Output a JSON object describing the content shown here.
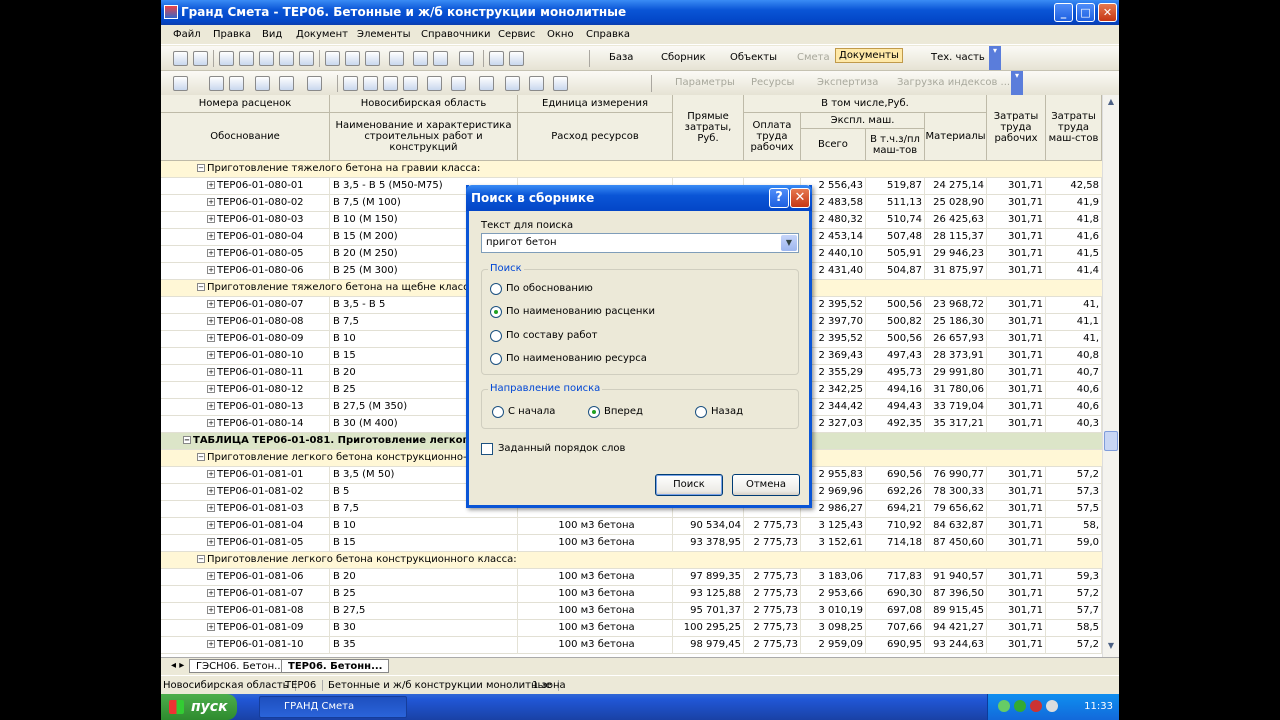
{
  "window": {
    "title": "Гранд Смета - ТЕР06. Бетонные и ж/б конструкции монолитные",
    "controls": {
      "minimize": "_",
      "restore": "□",
      "close": "✕"
    }
  },
  "menu": [
    "Файл",
    "Правка",
    "Вид",
    "Документ",
    "Элементы",
    "Справочники",
    "Сервис",
    "Окно",
    "Справка"
  ],
  "toolbar1": {
    "items": [
      {
        "label": "База",
        "icon": "database-icon",
        "disabled": false,
        "active": false
      },
      {
        "label": "Сборник",
        "icon": "collection-icon",
        "disabled": false,
        "active": false
      },
      {
        "label": "Объекты",
        "icon": "objects-icon",
        "disabled": false,
        "active": false
      },
      {
        "label": "Смета",
        "icon": "estimate-icon",
        "disabled": true,
        "active": false
      },
      {
        "label": "Документы",
        "icon": "documents-icon",
        "disabled": false,
        "active": true
      },
      {
        "label": "Тех. часть",
        "icon": "tech-part-icon",
        "disabled": false,
        "active": false
      }
    ]
  },
  "toolbar2": {
    "items": [
      {
        "label": "Параметры",
        "icon": "parameters-icon",
        "disabled": true
      },
      {
        "label": "Ресурсы",
        "icon": "resources-icon",
        "disabled": true
      },
      {
        "label": "Экспертиза",
        "icon": "expertise-icon",
        "disabled": true
      },
      {
        "label": "Загрузка индексов ...",
        "icon": "load-indexes-icon",
        "disabled": true
      }
    ]
  },
  "table": {
    "headers": {
      "col1_top": "Номера расценок",
      "col1_bottom": "Обоснование",
      "col2_top": "Новосибирская область",
      "col2_mid": "Наименование и характеристика\nстроительных работ и конструкций",
      "col3_top": "Единица измерения",
      "col3_bottom": "Расход ресурсов",
      "col4": "Прямые\nзатраты, Руб.",
      "incl": "В том числе,Руб.",
      "labor_pay": "Оплата\nтруда\nрабочих",
      "mach": "Экспл. маш.",
      "mach_total": "Всего",
      "mach_incl": "В т.ч.з/пл\nмаш-тов",
      "materials": "Материалы",
      "labor": "Затраты\nтруда\nрабочих",
      "labor_mach": "Затраты\nтруда\nмаш-стов"
    },
    "rows": [
      {
        "type": "grp",
        "text": "Приготовление тяжелого бетона на гравии класса:"
      },
      {
        "type": "item",
        "code": "ТЕР06-01-080-01",
        "name": "В 3,5 - В 5 (М50-М75)",
        "unit": "",
        "direct": "",
        "pay": "",
        "mtotal": "2 556,43",
        "mpay": "519,87",
        "mat": "24 275,14",
        "labor": "301,71",
        "lm": "42,58"
      },
      {
        "type": "item",
        "code": "ТЕР06-01-080-02",
        "name": "В 7,5 (М 100)",
        "unit": "",
        "direct": "",
        "pay": "",
        "mtotal": "2 483,58",
        "mpay": "511,13",
        "mat": "25 028,90",
        "labor": "301,71",
        "lm": "41,9"
      },
      {
        "type": "item",
        "code": "ТЕР06-01-080-03",
        "name": "В 10 (М 150)",
        "unit": "",
        "direct": "",
        "pay": "",
        "mtotal": "2 480,32",
        "mpay": "510,74",
        "mat": "26 425,63",
        "labor": "301,71",
        "lm": "41,8"
      },
      {
        "type": "item",
        "code": "ТЕР06-01-080-04",
        "name": "В 15 (М 200)",
        "unit": "",
        "direct": "",
        "pay": "",
        "mtotal": "2 453,14",
        "mpay": "507,48",
        "mat": "28 115,37",
        "labor": "301,71",
        "lm": "41,6"
      },
      {
        "type": "item",
        "code": "ТЕР06-01-080-05",
        "name": "В 20 (М 250)",
        "unit": "",
        "direct": "",
        "pay": "",
        "mtotal": "2 440,10",
        "mpay": "505,91",
        "mat": "29 946,23",
        "labor": "301,71",
        "lm": "41,5"
      },
      {
        "type": "item",
        "code": "ТЕР06-01-080-06",
        "name": "В 25 (М 300)",
        "unit": "",
        "direct": "",
        "pay": "",
        "mtotal": "2 431,40",
        "mpay": "504,87",
        "mat": "31 875,97",
        "labor": "301,71",
        "lm": "41,4"
      },
      {
        "type": "grp",
        "text": "Приготовление тяжелого бетона на щебне класса:"
      },
      {
        "type": "item",
        "code": "ТЕР06-01-080-07",
        "name": "В 3,5 - В 5",
        "unit": "",
        "direct": "",
        "pay": "",
        "mtotal": "2 395,52",
        "mpay": "500,56",
        "mat": "23 968,72",
        "labor": "301,71",
        "lm": "41,"
      },
      {
        "type": "item",
        "code": "ТЕР06-01-080-08",
        "name": "В 7,5",
        "unit": "",
        "direct": "",
        "pay": "",
        "mtotal": "2 397,70",
        "mpay": "500,82",
        "mat": "25 186,30",
        "labor": "301,71",
        "lm": "41,1"
      },
      {
        "type": "item",
        "code": "ТЕР06-01-080-09",
        "name": "В 10",
        "unit": "",
        "direct": "",
        "pay": "",
        "mtotal": "2 395,52",
        "mpay": "500,56",
        "mat": "26 657,93",
        "labor": "301,71",
        "lm": "41,"
      },
      {
        "type": "item",
        "code": "ТЕР06-01-080-10",
        "name": "В 15",
        "unit": "",
        "direct": "",
        "pay": "",
        "mtotal": "2 369,43",
        "mpay": "497,43",
        "mat": "28 373,91",
        "labor": "301,71",
        "lm": "40,8"
      },
      {
        "type": "item",
        "code": "ТЕР06-01-080-11",
        "name": "В 20",
        "unit": "",
        "direct": "",
        "pay": "",
        "mtotal": "2 355,29",
        "mpay": "495,73",
        "mat": "29 991,80",
        "labor": "301,71",
        "lm": "40,7"
      },
      {
        "type": "item",
        "code": "ТЕР06-01-080-12",
        "name": "В 25",
        "unit": "",
        "direct": "",
        "pay": "",
        "mtotal": "2 342,25",
        "mpay": "494,16",
        "mat": "31 780,06",
        "labor": "301,71",
        "lm": "40,6"
      },
      {
        "type": "item",
        "code": "ТЕР06-01-080-13",
        "name": "В 27,5 (М 350)",
        "unit": "",
        "direct": "",
        "pay": "",
        "mtotal": "2 344,42",
        "mpay": "494,43",
        "mat": "33 719,04",
        "labor": "301,71",
        "lm": "40,6"
      },
      {
        "type": "item",
        "code": "ТЕР06-01-080-14",
        "name": "В 30 (М 400)",
        "unit": "",
        "direct": "",
        "pay": "",
        "mtotal": "2 327,03",
        "mpay": "492,35",
        "mat": "35 317,21",
        "labor": "301,71",
        "lm": "40,3"
      },
      {
        "type": "tbl",
        "text": "ТАБЛИЦА ТЕР06-01-081. Приготовление легкого б"
      },
      {
        "type": "grp",
        "text": "Приготовление легкого бетона конструкционно-тепл"
      },
      {
        "type": "item",
        "code": "ТЕР06-01-081-01",
        "name": "В 3,5 (М 50)",
        "unit": "",
        "direct": "",
        "pay": "",
        "mtotal": "2 955,83",
        "mpay": "690,56",
        "mat": "76 990,77",
        "labor": "301,71",
        "lm": "57,2"
      },
      {
        "type": "item",
        "code": "ТЕР06-01-081-02",
        "name": "В 5",
        "unit": "",
        "direct": "",
        "pay": "",
        "mtotal": "2 969,96",
        "mpay": "692,26",
        "mat": "78 300,33",
        "labor": "301,71",
        "lm": "57,3"
      },
      {
        "type": "item",
        "code": "ТЕР06-01-081-03",
        "name": "В 7,5",
        "unit": "",
        "direct": "",
        "pay": "",
        "mtotal": "2 986,27",
        "mpay": "694,21",
        "mat": "79 656,62",
        "labor": "301,71",
        "lm": "57,5"
      },
      {
        "type": "item",
        "code": "ТЕР06-01-081-04",
        "name": "В 10",
        "unit": "100 м3 бетона",
        "direct": "90 534,04",
        "pay": "2 775,73",
        "mtotal": "3 125,43",
        "mpay": "710,92",
        "mat": "84 632,87",
        "labor": "301,71",
        "lm": "58,"
      },
      {
        "type": "item",
        "code": "ТЕР06-01-081-05",
        "name": "В 15",
        "unit": "100 м3 бетона",
        "direct": "93 378,95",
        "pay": "2 775,73",
        "mtotal": "3 152,61",
        "mpay": "714,18",
        "mat": "87 450,60",
        "labor": "301,71",
        "lm": "59,0"
      },
      {
        "type": "grp",
        "text": "Приготовление легкого бетона конструкционного класса:"
      },
      {
        "type": "item",
        "code": "ТЕР06-01-081-06",
        "name": "В 20",
        "unit": "100 м3 бетона",
        "direct": "97 899,35",
        "pay": "2 775,73",
        "mtotal": "3 183,06",
        "mpay": "717,83",
        "mat": "91 940,57",
        "labor": "301,71",
        "lm": "59,3"
      },
      {
        "type": "item",
        "code": "ТЕР06-01-081-07",
        "name": "В 25",
        "unit": "100 м3 бетона",
        "direct": "93 125,88",
        "pay": "2 775,73",
        "mtotal": "2 953,66",
        "mpay": "690,30",
        "mat": "87 396,50",
        "labor": "301,71",
        "lm": "57,2"
      },
      {
        "type": "item",
        "code": "ТЕР06-01-081-08",
        "name": "В 27,5",
        "unit": "100 м3 бетона",
        "direct": "95 701,37",
        "pay": "2 775,73",
        "mtotal": "3 010,19",
        "mpay": "697,08",
        "mat": "89 915,45",
        "labor": "301,71",
        "lm": "57,7"
      },
      {
        "type": "item",
        "code": "ТЕР06-01-081-09",
        "name": "В 30",
        "unit": "100 м3 бетона",
        "direct": "100 295,25",
        "pay": "2 775,73",
        "mtotal": "3 098,25",
        "mpay": "707,66",
        "mat": "94 421,27",
        "labor": "301,71",
        "lm": "58,5"
      },
      {
        "type": "item",
        "code": "ТЕР06-01-081-10",
        "name": "В 35",
        "unit": "100 м3 бетона",
        "direct": "98 979,45",
        "pay": "2 775,73",
        "mtotal": "2 959,09",
        "mpay": "690,95",
        "mat": "93 244,63",
        "labor": "301,71",
        "lm": "57,2"
      }
    ]
  },
  "sheet_tabs": [
    "ГЭСН06. Бетон...",
    "ТЕР06. Бетонн..."
  ],
  "status": [
    "Новосибирская область",
    "ТЕР06",
    "Бетонные и ж/б конструкции монолитные",
    "1 зона"
  ],
  "taskbar": {
    "start": "пуск",
    "task": "ГРАНД Смета",
    "clock": "11:33"
  },
  "dialog": {
    "title": "Поиск в сборнике",
    "help": "?",
    "close": "✕",
    "search_label": "Текст для поиска",
    "search_value": "пригот бетон",
    "group_search": "Поиск",
    "radios": [
      {
        "label": "По обоснованию",
        "checked": false
      },
      {
        "label": "По наименованию расценки",
        "checked": true
      },
      {
        "label": "По составу работ",
        "checked": false
      },
      {
        "label": "По наименованию ресурса",
        "checked": false
      }
    ],
    "group_direction": "Направление поиска",
    "directions": [
      {
        "label": "С начала",
        "checked": false
      },
      {
        "label": "Вперед",
        "checked": true
      },
      {
        "label": "Назад",
        "checked": false
      }
    ],
    "checkbox_label": "Заданный порядок слов",
    "checkbox_checked": false,
    "ok": "Поиск",
    "cancel": "Отмена"
  }
}
